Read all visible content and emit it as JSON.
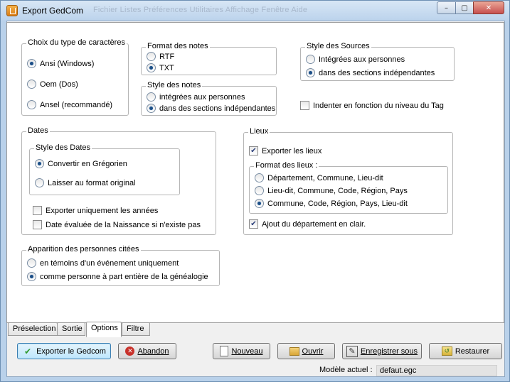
{
  "window": {
    "title": "Export GedCom",
    "menu_ghost": "Fichier   Listes   Préférences   Utilitaires   Affichage   Fenêtre   Aide",
    "minimize_glyph": "–",
    "maximize_glyph": "▢",
    "close_glyph": "✕"
  },
  "charset": {
    "legend": "Choix du type de caractères",
    "options": [
      "Ansi (Windows)",
      "Oem (Dos)",
      "Ansel (recommandé)"
    ],
    "selected": 0
  },
  "notes_format": {
    "legend": "Format des notes",
    "options": [
      "RTF",
      "TXT"
    ],
    "selected": 1
  },
  "notes_style": {
    "legend": "Style des notes",
    "options": [
      "intégrées aux personnes",
      "dans des sections indépendantes"
    ],
    "selected": 1
  },
  "sources_style": {
    "legend": "Style des Sources",
    "options": [
      "Intégrées aux personnes",
      "dans des sections indépendantes"
    ],
    "selected": 1
  },
  "indent": {
    "label": "Indenter en fonction du niveau du Tag",
    "checked": false
  },
  "dates": {
    "legend": "Dates",
    "style_legend": "Style des Dates",
    "style_options": [
      "Convertir en Grégorien",
      "Laisser au format original"
    ],
    "style_selected": 0,
    "years_only": {
      "label": "Exporter uniquement les années",
      "checked": false
    },
    "birth_eval": {
      "label": "Date évaluée de la Naissance si n'existe pas",
      "checked": false
    }
  },
  "places": {
    "legend": "Lieux",
    "export": {
      "label": "Exporter les lieux",
      "checked": true
    },
    "format_legend": "Format des lieux :",
    "format_options": [
      "Département, Commune, Lieu-dit",
      "Lieu-dit, Commune, Code, Région, Pays",
      "Commune, Code, Région, Pays, Lieu-dit"
    ],
    "format_selected": 2,
    "add_dept": {
      "label": "Ajout du département en clair.",
      "checked": true
    }
  },
  "cited": {
    "legend": "Apparition des personnes citées",
    "options": [
      "en témoins d'un événement uniquement",
      "comme personne à part entière de la généalogie"
    ],
    "selected": 1
  },
  "tabs": [
    {
      "label": "Préselection",
      "active": false
    },
    {
      "label": "Sortie",
      "active": false
    },
    {
      "label": "Options",
      "active": true
    },
    {
      "label": "Filtre",
      "active": false
    }
  ],
  "buttons": {
    "export": {
      "label": "Exporter le Gedcom",
      "icon": "check-icon"
    },
    "abandon": {
      "label": "Abandon",
      "icon": "cancel-icon"
    },
    "new": {
      "label": "Nouveau",
      "icon": "new-file-icon"
    },
    "open": {
      "label": "Ouvrir",
      "icon": "open-folder-icon"
    },
    "save_as": {
      "label": "Enregistrer sous",
      "icon": "save-as-icon"
    },
    "restore": {
      "label": "Restaurer",
      "icon": "restore-icon"
    }
  },
  "model": {
    "label": "Modèle actuel :",
    "value": "defaut.egc"
  },
  "colors": {
    "title_bg": "#bcd3ec",
    "primary_button": "#bee6fd",
    "radio_dot": "#1c4e86"
  }
}
